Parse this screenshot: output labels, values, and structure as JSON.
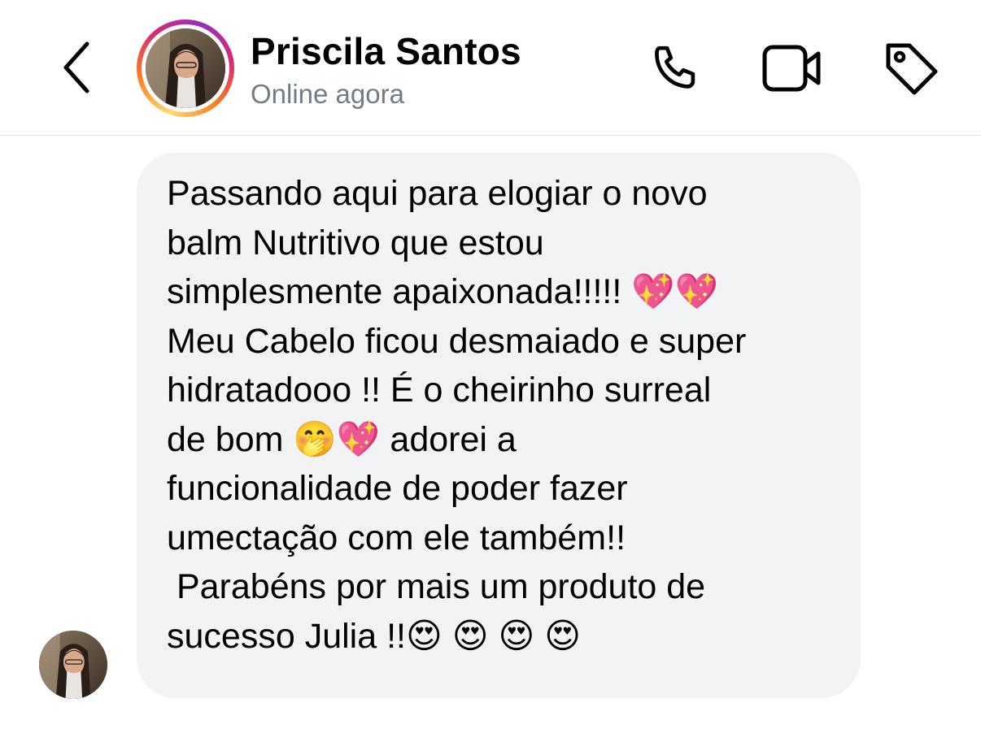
{
  "header": {
    "contact_name": "Priscila Santos",
    "status": "Online agora",
    "icons": {
      "back": "chevron-left-icon",
      "call": "phone-icon",
      "video": "video-camera-icon",
      "tag": "tag-icon"
    }
  },
  "message": {
    "text": "Passando aqui para elogiar o novo\nbalm Nutritivo que estou\nsimplesmente apaixonada!!!!! 💖💖\nMeu Cabelo ficou desmaiado e super\nhidratadooo !! É o cheirinho surreal\nde bom 🤭💖 adorei a\nfuncionalidade de poder fazer\numectação com ele também!!\n Parabéns por mais um produto de\nsucesso Julia !!😍 😍 😍 😍"
  },
  "colors": {
    "bubble_background": "#f2f3f5",
    "status_gray": "#737b85",
    "divider": "#e6e6e6"
  }
}
